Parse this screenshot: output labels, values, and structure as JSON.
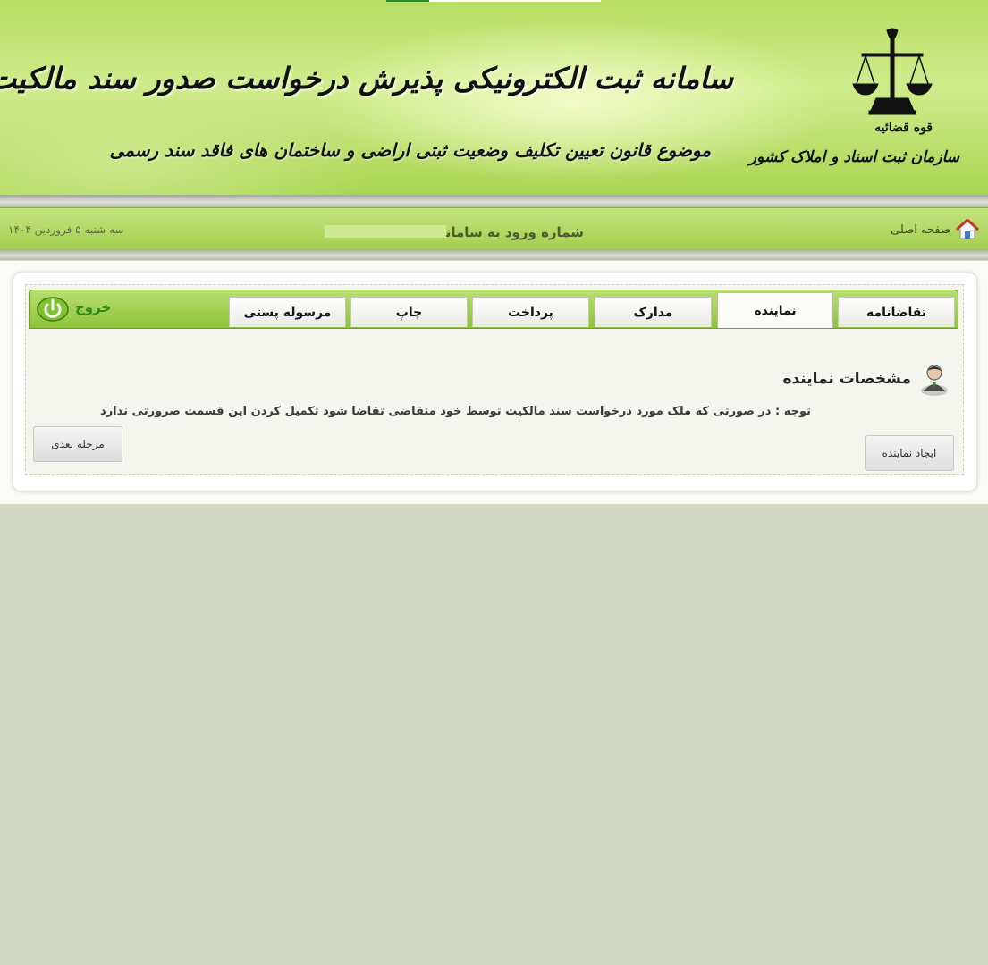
{
  "header": {
    "title": "سامانه ثبت الکترونیکی پذیرش درخواست صدور سند مالکیت",
    "subtitle": "موضوع قانون تعیین تکلیف وضعیت ثبتی اراضی و ساختمان های فاقد سند رسمی",
    "org_sub": "قوه قضائیه",
    "org_main": "سازمان ثبت اسناد و املاک کشور"
  },
  "navbar": {
    "home_label": "صفحه اصلی",
    "login_label": "شماره ورود به سامانه :",
    "date": "سه شنبه ۵ فروردین ۱۴۰۴"
  },
  "tabs": [
    {
      "label": "تقاضانامه",
      "active": false
    },
    {
      "label": "نماینده",
      "active": true
    },
    {
      "label": "مدارک",
      "active": false
    },
    {
      "label": "پرداخت",
      "active": false
    },
    {
      "label": "چاپ",
      "active": false
    },
    {
      "label": "مرسوله پستی",
      "active": false
    }
  ],
  "logout_label": "خروج",
  "content": {
    "section_title": "مشخصات نماینده",
    "note": "توجه : در صورتی که ملک مورد درخواست سند مالکیت توسط خود متقاضی تقاضا شود تکمیل کردن این قسمت ضرورتی ندارد",
    "create_button": "ایجاد نماینده",
    "next_button": "مرحله بعدی"
  },
  "colors": {
    "header_green": "#b7de62",
    "nav_green": "#a4d050",
    "logout_green": "#2f8a18",
    "page_bg": "#d3d9c5"
  },
  "icons": {
    "home": "home-icon",
    "logout": "power-icon",
    "section": "user-icon",
    "emblem": "scales-emblem-icon"
  }
}
